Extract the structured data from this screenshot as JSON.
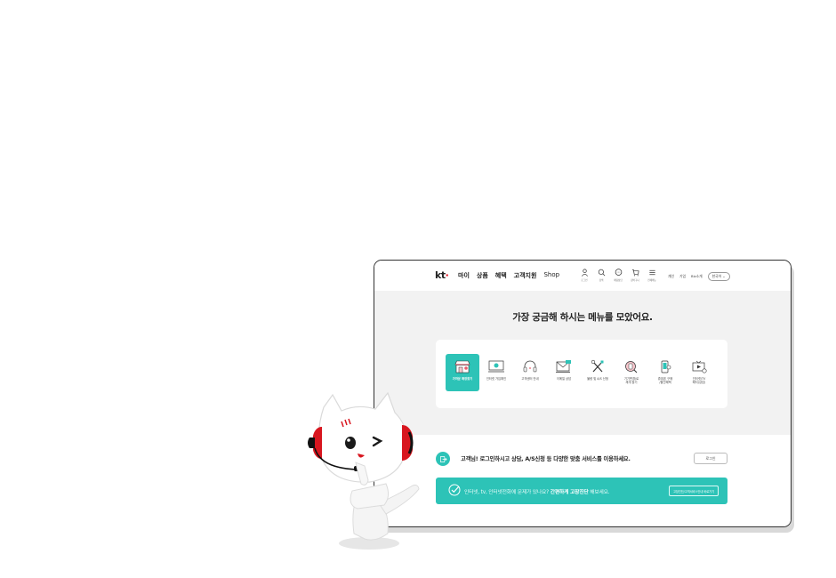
{
  "header": {
    "logo": "kt",
    "gnb": [
      "마이",
      "상품",
      "혜택",
      "고객지원",
      "Shop"
    ],
    "util_icons": [
      {
        "icon": "user-icon",
        "label": "로그인"
      },
      {
        "icon": "search-icon",
        "label": "검색"
      },
      {
        "icon": "chat-icon",
        "label": "채팅상담"
      },
      {
        "icon": "cart-icon",
        "label": "장바구니"
      },
      {
        "icon": "menu-icon",
        "label": "전체메뉴"
      }
    ],
    "util_links": [
      "개인",
      "기업",
      "Biz소개"
    ],
    "lang_button": "한국어 ⌄"
  },
  "hero": {
    "title": "가장 궁금해 하시는 메뉴를 모았어요.",
    "menu_items": [
      {
        "icon": "store-icon",
        "label": "가까운 매장찾기",
        "active": true
      },
      {
        "icon": "monitor-icon",
        "label": "인터넷 가입확인",
        "active": false
      },
      {
        "icon": "headset-icon",
        "label": "고객센터 안내",
        "active": false
      },
      {
        "icon": "email-icon",
        "label": "이메일 상담",
        "active": false
      },
      {
        "icon": "tools-icon",
        "label": "불량 및 A/S 신청",
        "active": false
      },
      {
        "icon": "device-search-icon",
        "label": "기기변경/로\n재개 찾기",
        "active": false
      },
      {
        "icon": "phone-repair-icon",
        "label": "휴대폰 구매\n/할인혜택",
        "active": false
      },
      {
        "icon": "tv-icon",
        "label": "인터넷/TV\n해지(상담)",
        "active": false
      }
    ]
  },
  "login_notice": {
    "text": "고객님! 로그인하시고 상담, A/S신청 등 다양한 맞춤 서비스를 이용하세요.",
    "button": "로그인"
  },
  "diagnosis": {
    "text_pre": "인터넷, tv, 인터넷전화에 문제가 있나요?",
    "text_bold": "간편하게 고장진단",
    "text_post": "해보세요.",
    "button": "고장진단/고객서비스안내 바로가기"
  },
  "colors": {
    "accent": "#2dc3b7",
    "brand_red": "#e60012",
    "hero_bg": "#f2f2f2"
  }
}
